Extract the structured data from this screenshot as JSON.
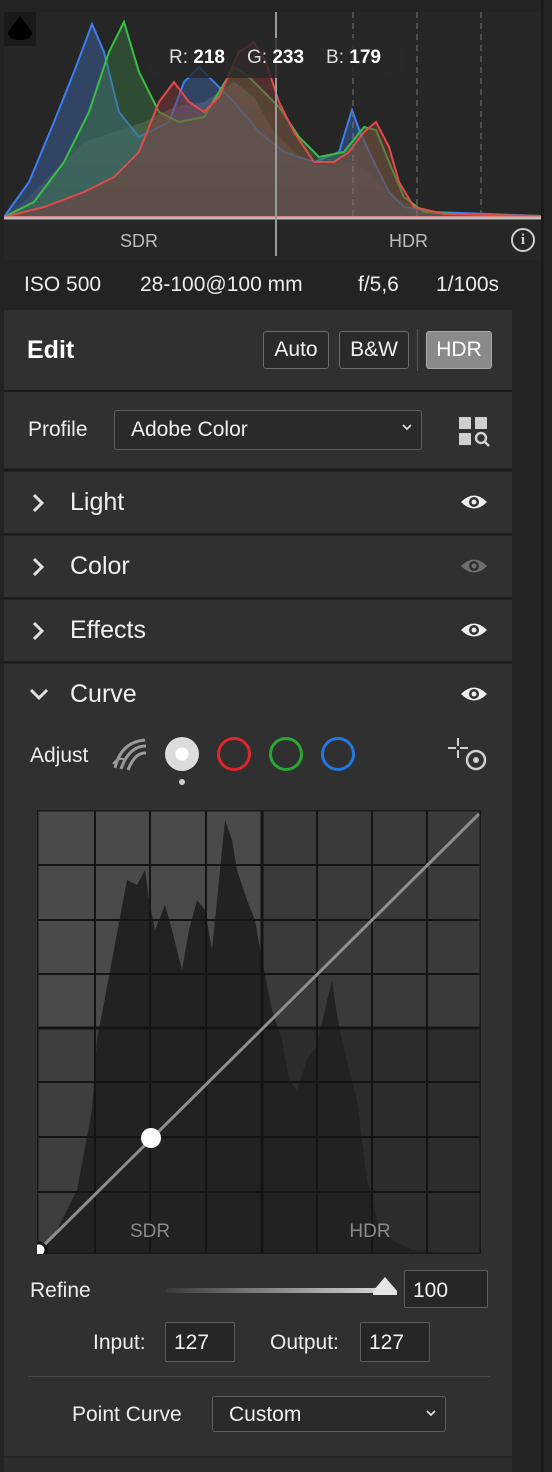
{
  "histogram": {
    "readout": {
      "r_label": "R:",
      "r_value": "218",
      "g_label": "G:",
      "g_value": "233",
      "b_label": "B:",
      "b_value": "179"
    },
    "zones": {
      "sdr": "SDR",
      "hdr": "HDR"
    },
    "info_icon": "info-icon"
  },
  "exif": {
    "iso": "ISO 500",
    "lens": "28-100@100 mm",
    "aperture": "f/5,6",
    "shutter": "1/100s"
  },
  "edit": {
    "title": "Edit",
    "buttons": {
      "auto": "Auto",
      "bw": "B&W",
      "hdr": "HDR"
    },
    "active_mode": "HDR"
  },
  "profile": {
    "label": "Profile",
    "value": "Adobe Color",
    "browse_icon": "profile-browser-icon"
  },
  "sections": [
    {
      "name": "Light",
      "expanded": false,
      "visible": true
    },
    {
      "name": "Color",
      "expanded": false,
      "visible": false
    },
    {
      "name": "Effects",
      "expanded": false,
      "visible": true
    }
  ],
  "curve": {
    "name": "Curve",
    "expanded": true,
    "adjust_label": "Adjust",
    "channels": [
      "parametric",
      "point",
      "red",
      "green",
      "blue"
    ],
    "selected_channel": "point",
    "graph_labels": {
      "sdr": "SDR",
      "hdr": "HDR"
    },
    "points": [
      {
        "input": 0,
        "output": 0
      },
      {
        "input": 127,
        "output": 127
      }
    ],
    "refine_label": "Refine",
    "refine_value": "100",
    "input_label": "Input:",
    "input_value": "127",
    "output_label": "Output:",
    "output_value": "127",
    "point_curve_label": "Point Curve",
    "point_curve_value": "Custom"
  },
  "colors": {
    "red": "#e0262d",
    "green": "#2aa733",
    "blue": "#2476e0",
    "panel": "#303030"
  }
}
